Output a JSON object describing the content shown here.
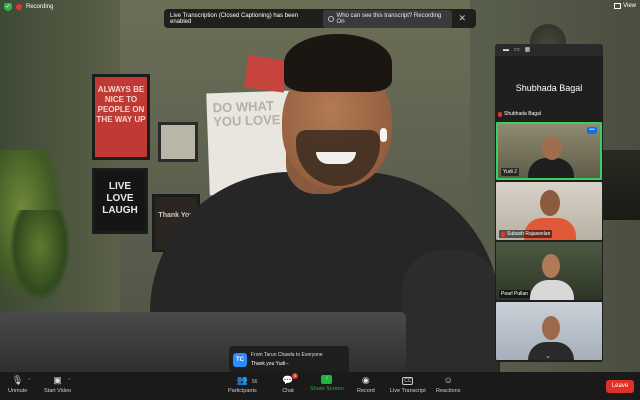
{
  "top_bar": {
    "recording_label": "Recording",
    "view_label": "View"
  },
  "banner": {
    "message": "Live Transcription (Closed Captioning) has been enabled",
    "pill_label": "Who can see this transcript? Recording On",
    "close_glyph": "✕"
  },
  "scene": {
    "frame_red_text": "ALWAYS BE NICE TO PEOPLE ON THE WAY UP",
    "frame_black_text": "LIVE LOVE LAUGH",
    "frame_dark_text": "Thank You",
    "poster_text": "DO WHAT YOU LOVE"
  },
  "gallery": {
    "featured_name": "Shubhada Bagal",
    "featured_sub_label": "Shubhada Bagal",
    "tiles": [
      {
        "label": "Yudi J",
        "active": true,
        "more": "•••"
      },
      {
        "label": "Subash Rajaseelan",
        "active": false
      },
      {
        "label": "Pearl Pullan",
        "active": false
      },
      {
        "label": "",
        "active": false
      }
    ],
    "down_glyph": "⌄"
  },
  "chat_toast": {
    "avatar": "TC",
    "from": "From Tarun Chawla to Everyone",
    "message": "Thank you Yudi--"
  },
  "toolbar": {
    "unmute": "Unmute",
    "start_video": "Start Video",
    "participants": "Participants",
    "participants_count": "56",
    "chat": "Chat",
    "chat_badge": "5",
    "share_screen": "Share Screen",
    "record": "Record",
    "live_transcript": "Live Transcript",
    "reactions": "Reactions",
    "leave": "Leave"
  },
  "colors": {
    "accent_green": "#1fb541",
    "leave_red": "#e0302a",
    "active_border": "#3bd15f",
    "toolbar_bg": "#1a1a1a"
  }
}
